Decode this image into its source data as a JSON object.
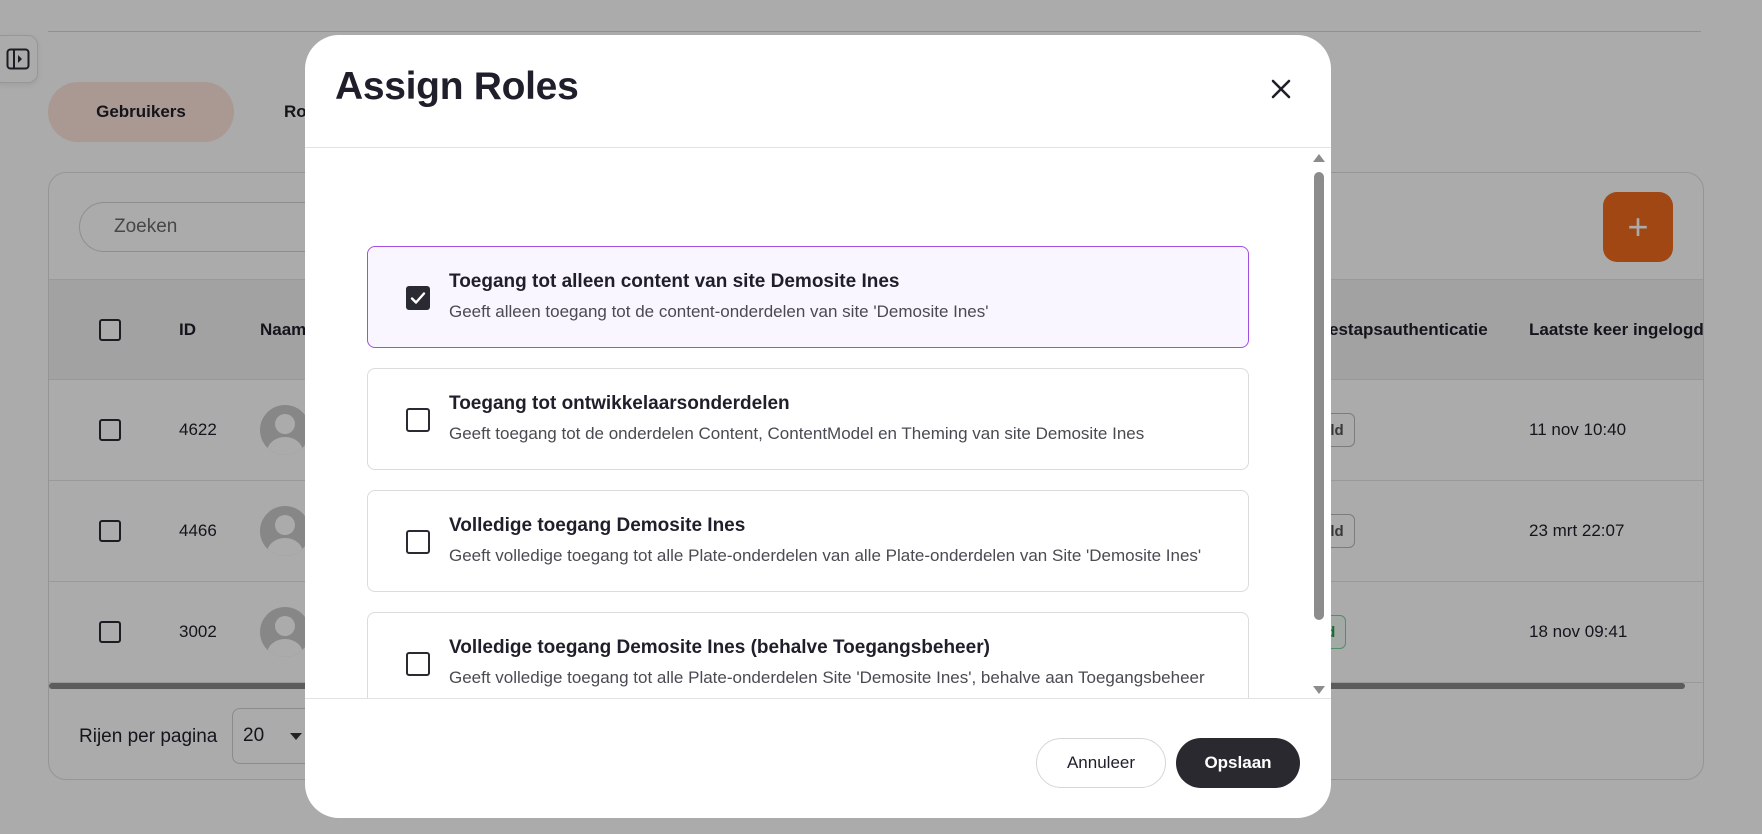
{
  "background": {
    "tabs": [
      {
        "label": "Gebruikers",
        "active": true
      },
      {
        "label": "Ro"
      }
    ],
    "search": {
      "placeholder": "Zoeken"
    },
    "add_button": {
      "icon": "plus-icon",
      "label": "+",
      "color": "#f06a1d"
    },
    "table": {
      "headers": {
        "id": "ID",
        "name": "Naam",
        "twofactor": "estapsauthenticatie",
        "last_login": "Laatste keer ingelogd"
      },
      "rows": [
        {
          "id": "4622",
          "twofactor": "eld",
          "last_login": "11 nov 10:40"
        },
        {
          "id": "4466",
          "twofactor": "eld",
          "last_login": "23 mrt 22:07"
        },
        {
          "id": "3002",
          "twofactor": "ld",
          "last_login": "18 nov 09:41"
        }
      ]
    },
    "footer": {
      "rows_per_page_label": "Rijen per pagina",
      "rows_per_page_value": "20"
    }
  },
  "modal": {
    "title": "Assign Roles",
    "roles": [
      {
        "name": "Toegang tot alleen content van site Demosite Ines",
        "description": "Geeft alleen toegang tot de content-onderdelen van site 'Demosite Ines'",
        "checked": true
      },
      {
        "name": "Toegang tot ontwikkelaarsonderdelen",
        "description": "Geeft toegang tot de onderdelen Content, ContentModel en Theming van site Demosite Ines",
        "checked": false
      },
      {
        "name": "Volledige toegang Demosite Ines",
        "description": "Geeft volledige toegang tot alle Plate-onderdelen van alle Plate-onderdelen van Site 'Demosite Ines'",
        "checked": false
      },
      {
        "name": "Volledige toegang Demosite Ines (behalve Toegangsbeheer)",
        "description": "Geeft volledige toegang tot alle Plate-onderdelen Site 'Demosite Ines', behalve aan Toegangsbeheer",
        "checked": false
      }
    ],
    "buttons": {
      "cancel": "Annuleer",
      "save": "Opslaan"
    },
    "colors": {
      "selected_border": "#a14fe0",
      "primary_button": "#2b2930"
    }
  }
}
